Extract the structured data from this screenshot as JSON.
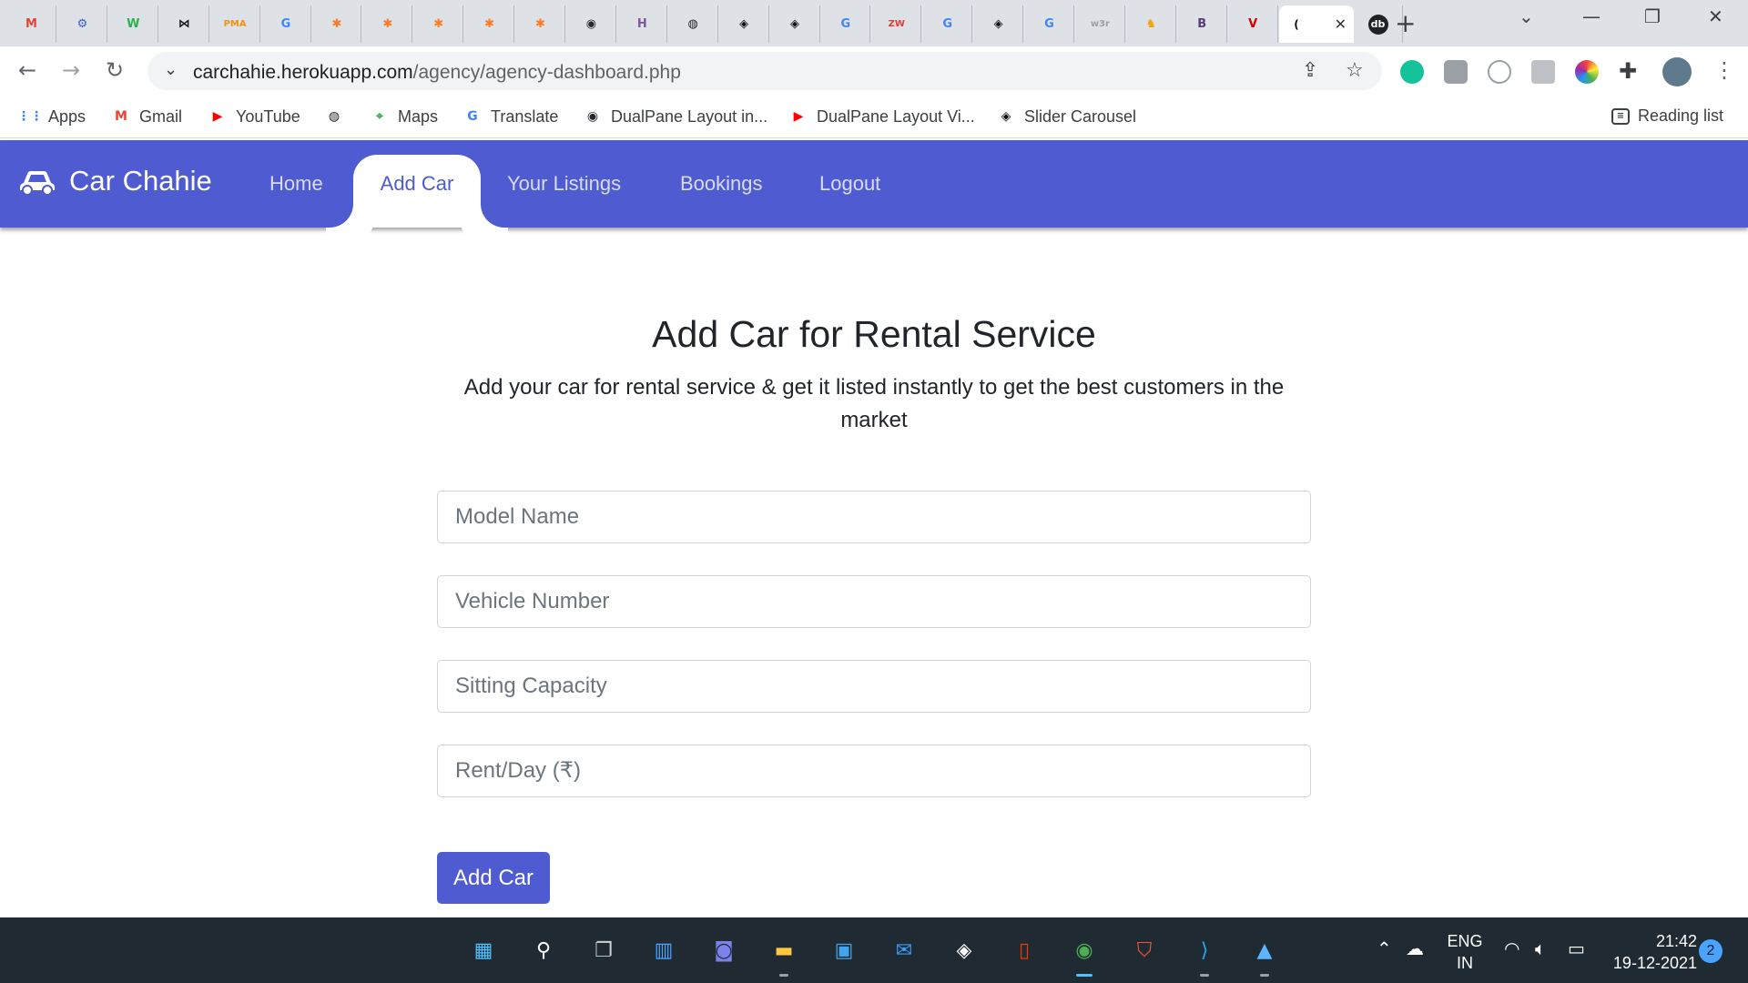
{
  "browser": {
    "tabs": [
      {
        "icon": "gmail-icon",
        "glyph": "M",
        "color": "#ea4335"
      },
      {
        "icon": "settings-site-icon",
        "glyph": "⚙",
        "color": "#3b5bdb"
      },
      {
        "icon": "w-site-icon",
        "glyph": "W",
        "color": "#2bb24c"
      },
      {
        "icon": "bow-icon",
        "glyph": "⋈",
        "color": "#111111"
      },
      {
        "icon": "phpmyadmin-icon",
        "glyph": "PMA",
        "color": "#f29111"
      },
      {
        "icon": "google-icon",
        "glyph": "G",
        "color": "#4285f4"
      },
      {
        "icon": "xampp-icon",
        "glyph": "✱",
        "color": "#fb7a24"
      },
      {
        "icon": "xampp-icon",
        "glyph": "✱",
        "color": "#fb7a24"
      },
      {
        "icon": "xampp-icon",
        "glyph": "✱",
        "color": "#fb7a24"
      },
      {
        "icon": "xampp-icon",
        "glyph": "✱",
        "color": "#fb7a24"
      },
      {
        "icon": "xampp-icon",
        "glyph": "✱",
        "color": "#fb7a24"
      },
      {
        "icon": "github-icon",
        "glyph": "◉",
        "color": "#24292e"
      },
      {
        "icon": "heroku-icon",
        "glyph": "H",
        "color": "#79589f"
      },
      {
        "icon": "globe-icon",
        "glyph": "◍",
        "color": "#202124"
      },
      {
        "icon": "codepen-icon",
        "glyph": "◈",
        "color": "#111111"
      },
      {
        "icon": "codepen-icon",
        "glyph": "◈",
        "color": "#111111"
      },
      {
        "icon": "google-icon",
        "glyph": "G",
        "color": "#4285f4"
      },
      {
        "icon": "zw-icon",
        "glyph": "ZW",
        "color": "#e53935"
      },
      {
        "icon": "google-icon",
        "glyph": "G",
        "color": "#4285f4"
      },
      {
        "icon": "codepen-icon",
        "glyph": "◈",
        "color": "#111111"
      },
      {
        "icon": "google-icon",
        "glyph": "G",
        "color": "#4285f4"
      },
      {
        "icon": "w3r-icon",
        "glyph": "w3r",
        "color": "#9e9e9e"
      },
      {
        "icon": "figure-icon",
        "glyph": "♞",
        "color": "#f0a30a"
      },
      {
        "icon": "bootstrap-icon",
        "glyph": "B",
        "color": "#563d7c"
      },
      {
        "icon": "v-icon",
        "glyph": "V",
        "color": "#d50000"
      }
    ],
    "active_tab_favicon": "codepen-icon",
    "address_bar": {
      "domain": "carchahie.herokuapp.com",
      "path": "/agency/agency-dashboard.php"
    },
    "bookmarks": [
      {
        "label": "Apps",
        "icon": "apps-grid-icon",
        "glyph": "⋮⋮",
        "color": "#4285f4"
      },
      {
        "label": "Gmail",
        "icon": "gmail-icon",
        "glyph": "M",
        "color": "#ea4335"
      },
      {
        "label": "YouTube",
        "icon": "youtube-icon",
        "glyph": "▶",
        "color": "#ff0000"
      },
      {
        "label": "",
        "icon": "globe-icon",
        "glyph": "◍",
        "color": "#202124"
      },
      {
        "label": "Maps",
        "icon": "maps-icon",
        "glyph": "⌖",
        "color": "#34a853"
      },
      {
        "label": "Translate",
        "icon": "translate-icon",
        "glyph": "G",
        "color": "#4285f4"
      },
      {
        "label": "DualPane Layout in...",
        "icon": "github-icon",
        "glyph": "◉",
        "color": "#24292e"
      },
      {
        "label": "DualPane Layout Vi...",
        "icon": "youtube-icon",
        "glyph": "▶",
        "color": "#ff0000"
      },
      {
        "label": "Slider Carousel",
        "icon": "codepen-icon",
        "glyph": "◈",
        "color": "#111111"
      }
    ],
    "reading_list": "Reading list"
  },
  "site": {
    "brand": "Car Chahie",
    "nav": {
      "home": "Home",
      "add_car": "Add Car",
      "listings": "Your Listings",
      "bookings": "Bookings",
      "logout": "Logout"
    },
    "colors": {
      "primary": "#4f5bd0"
    }
  },
  "form": {
    "heading": "Add Car for Rental Service",
    "subtitle": "Add your car for rental service & get it listed instantly to get the best customers in the market",
    "fields": {
      "model_name": "Model Name",
      "vehicle_number": "Vehicle Number",
      "sitting_capacity": "Sitting Capacity",
      "rent_per_day": "Rent/Day (₹)"
    },
    "submit_label": "Add Car"
  },
  "taskbar": {
    "apps": [
      "windows-start-icon",
      "search-icon",
      "task-view-icon",
      "widgets-icon",
      "teams-chat-icon",
      "file-explorer-icon",
      "microsoft-store-icon",
      "mail-icon",
      "unity-icon",
      "office-icon",
      "chrome-icon",
      "brave-icon",
      "vscode-icon",
      "photos-icon"
    ],
    "language": "ENG",
    "region": "IN",
    "time": "21:42",
    "date": "19-12-2021",
    "notifications": "2"
  }
}
